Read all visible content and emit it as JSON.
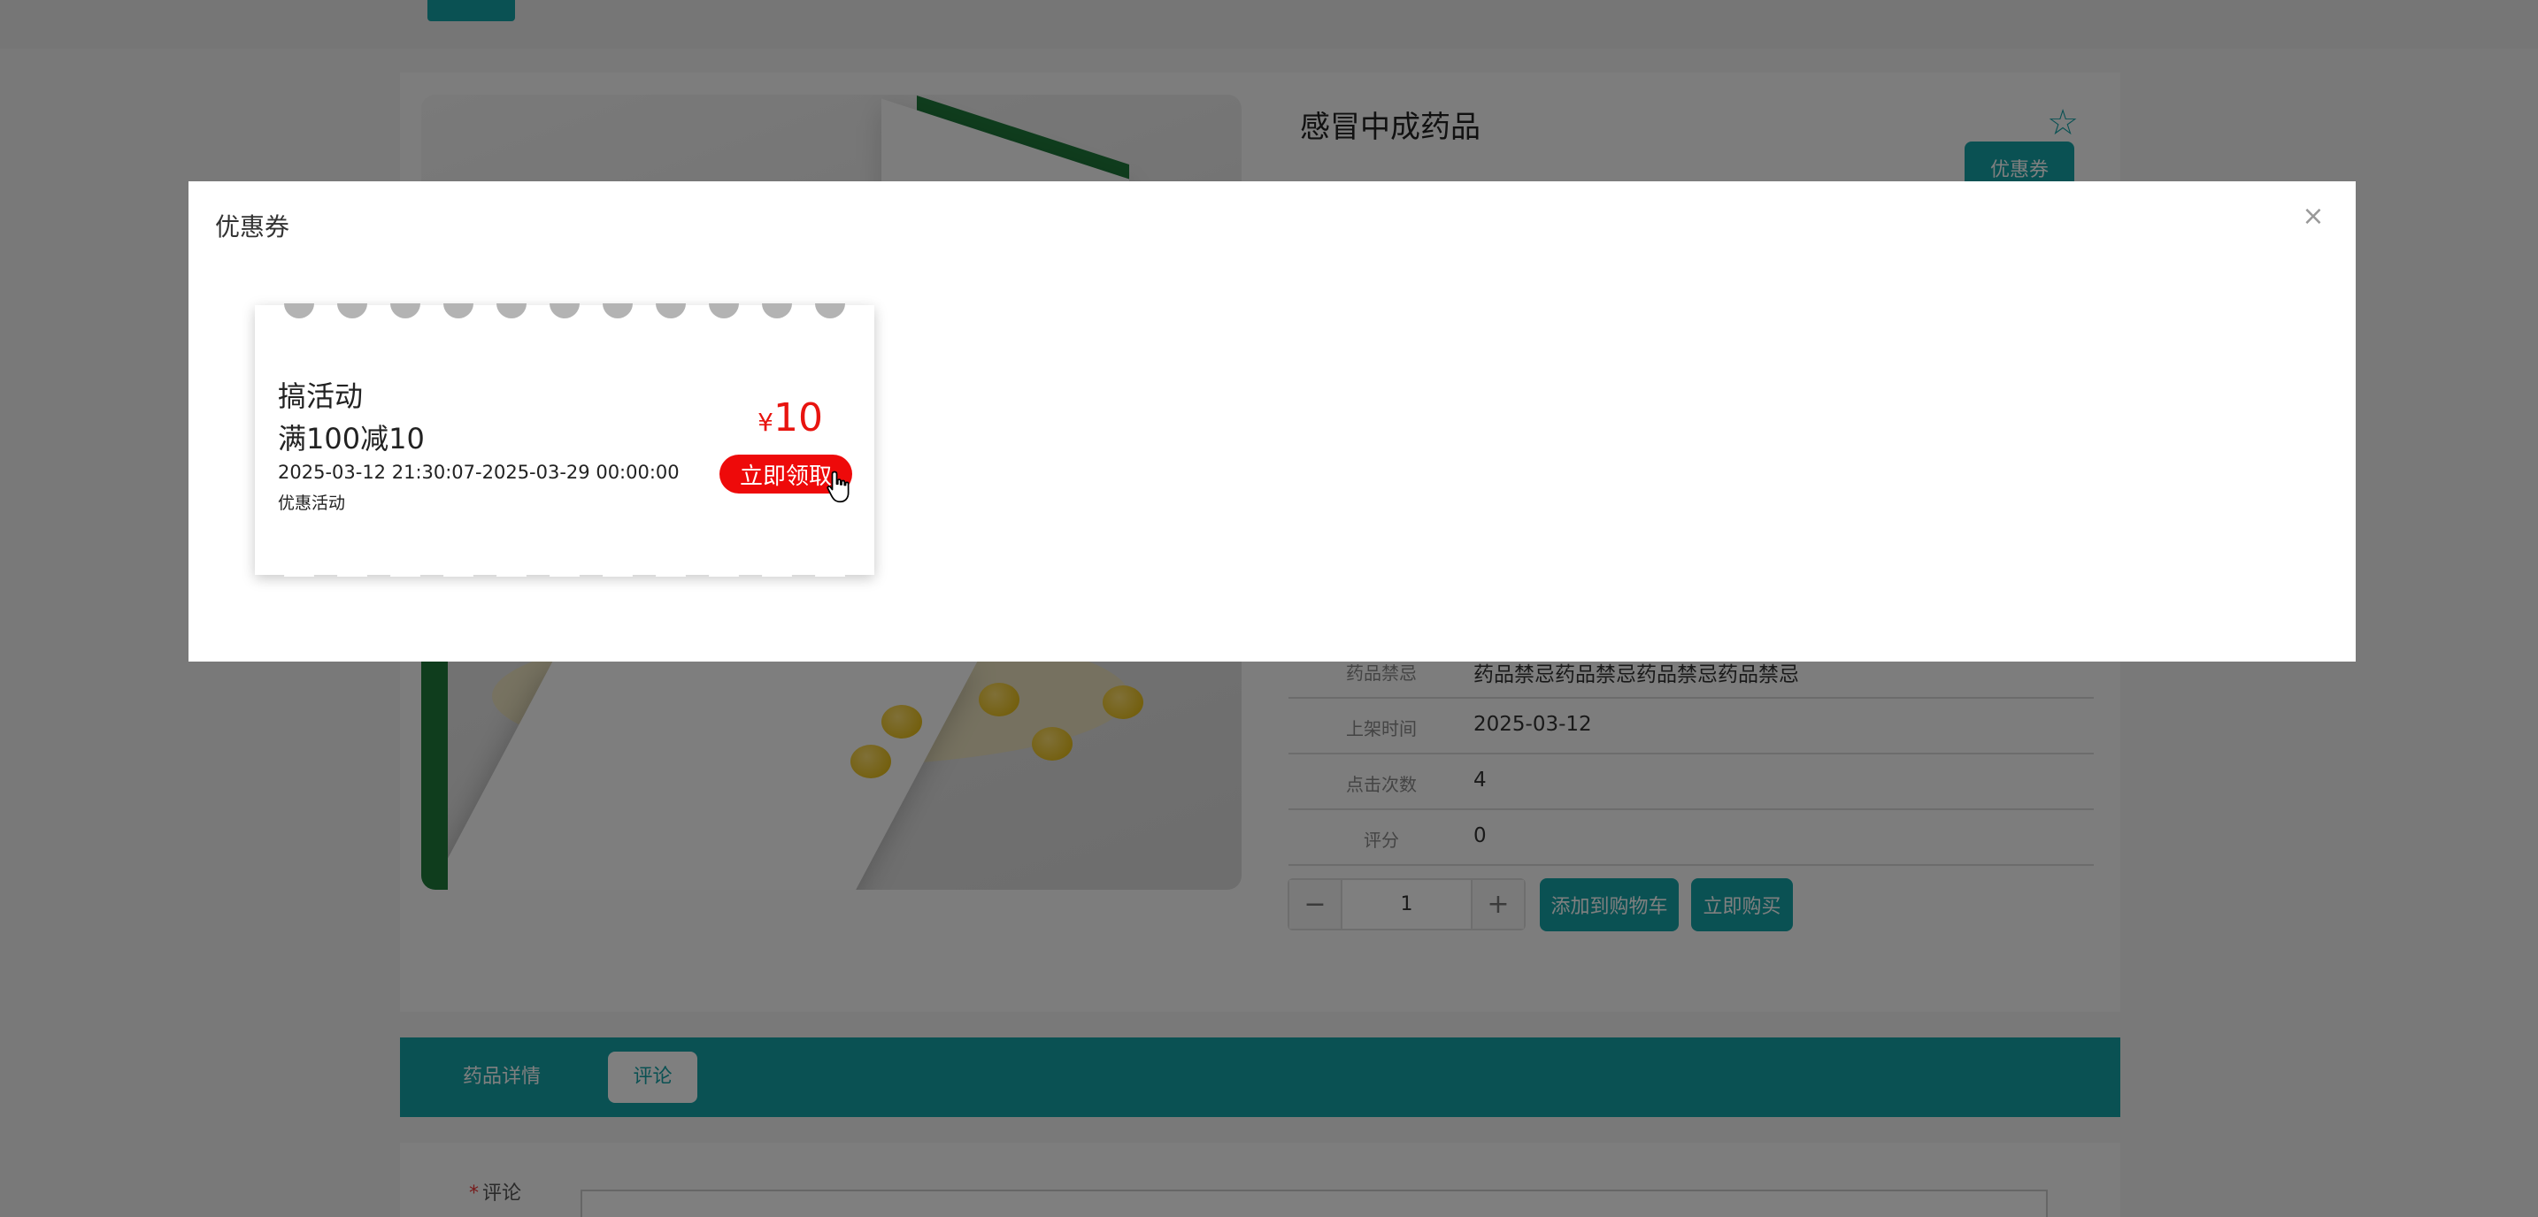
{
  "product": {
    "title": "感冒中成药品",
    "coupon_button": "优惠券",
    "info_rows": [
      {
        "label": "药品禁忌",
        "value": "药品禁忌药品禁忌药品禁忌药品禁忌"
      },
      {
        "label": "上架时间",
        "value": "2025-03-12"
      },
      {
        "label": "点击次数",
        "value": "4"
      },
      {
        "label": "评分",
        "value": "0"
      }
    ],
    "quantity": "1",
    "minus_label": "−",
    "plus_label": "+",
    "add_to_cart": "添加到购物车",
    "buy_now": "立即购买"
  },
  "tabs": [
    {
      "label": "药品详情",
      "active": false
    },
    {
      "label": "评论",
      "active": true
    }
  ],
  "comment": {
    "required_mark": "*",
    "label": "评论"
  },
  "dialog": {
    "title": "优惠券",
    "close_label": "×",
    "coupons": [
      {
        "name": "搞活动",
        "rule": "满100减10",
        "period": "2025-03-12 21:30:07-2025-03-29 00:00:00",
        "type": "优惠活动",
        "currency": "¥",
        "amount": "10",
        "claim_label": "立即领取"
      }
    ]
  },
  "colors": {
    "accent": "#14a3a7",
    "claim_red": "#ee0a0a",
    "amount_red": "#e8140f"
  },
  "icons": {
    "favorite": "star-icon",
    "close": "close-icon",
    "pointer": "hand-cursor-icon"
  }
}
